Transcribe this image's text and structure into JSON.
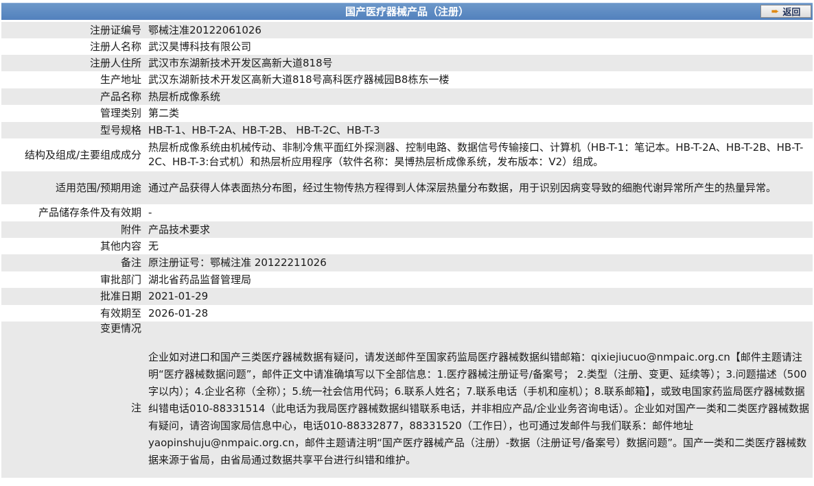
{
  "header": {
    "title": "国产医疗器械产品（注册）",
    "back_label": "返回"
  },
  "rows": [
    {
      "label": "注册证编号",
      "value": "鄂械注准20122061026"
    },
    {
      "label": "注册人名称",
      "value": "武汉昊博科技有限公司"
    },
    {
      "label": "注册人住所",
      "value": "武汉市东湖新技术开发区高新大道818号"
    },
    {
      "label": "生产地址",
      "value": "武汉东湖新技术开发区高新大道818号高科医疗器械园B8栋东一楼"
    },
    {
      "label": "产品名称",
      "value": "热层析成像系统"
    },
    {
      "label": "管理类别",
      "value": "第二类"
    },
    {
      "label": "型号规格",
      "value": "HB-T-1、HB-T-2A、HB-T-2B、 HB-T-2C、HB-T-3"
    },
    {
      "label": "结构及组成/主要组成成分",
      "value": "热层析成像系统由机械传动、非制冷焦平面红外探测器、控制电路、数据信号传输接口、计算机（HB-T-1：笔记本。HB-T-2A、HB-T-2B、HB-T-2C、HB-T-3:台式机）和热层析应用程序（软件名称：昊博热层析成像系统，发布版本：V2）组成。"
    },
    {
      "label": "适用范围/预期用途",
      "value": "通过产品获得人体表面热分布图，经过生物传热方程得到人体深层热量分布数据，用于识别因病变导致的细胞代谢异常所产生的热量异常。"
    },
    {
      "label": "产品储存条件及有效期",
      "value": "-"
    },
    {
      "label": "附件",
      "value": "产品技术要求"
    },
    {
      "label": "其他内容",
      "value": "无"
    },
    {
      "label": "备注",
      "value": "原注册证号：鄂械注准 20122211026"
    },
    {
      "label": "审批部门",
      "value": "湖北省药品监督管理局"
    },
    {
      "label": "批准日期",
      "value": "2021-01-29"
    },
    {
      "label": "有效期至",
      "value": "2026-01-28"
    },
    {
      "label": "变更情况",
      "value": ""
    }
  ],
  "note": {
    "label": "注",
    "text": "企业如对进口和国产三类医疗器械数据有疑问，请发送邮件至国家药监局医疗器械数据纠错邮箱：qixiejiucuo@nmpaic.org.cn【邮件主题请注明“医疗器械数据问题”，邮件正文中请准确填写以下全部信息：1.医疗器械注册证号/备案号； 2.类型（注册、变更、延续等）；3.问题描述（500字以内）；4.企业名称（全称）；5.统一社会信用代码；6.联系人姓名；7.联系电话（手机和座机）；8.联系邮箱】，或致电国家药监局医疗器械数据纠错电话010-88331514（此电话为我局医疗器械数据纠错联系电话，并非相应产品/企业业务咨询电话）。企业如对国产一类和二类医疗器械数据有疑问，请咨询国家局信息中心，电话010-88332877，88331520（工作日），也可通过发邮件与我们联系：邮件地址yaopinshuju@nmpaic.org.cn，邮件主题请注明“国产医疗器械产品（注册）-数据（注册证号/备案号）数据问题”。国产一类和二类医疗器械数据来源于省局，由省局通过数据共享平台进行纠错和维护。"
  }
}
